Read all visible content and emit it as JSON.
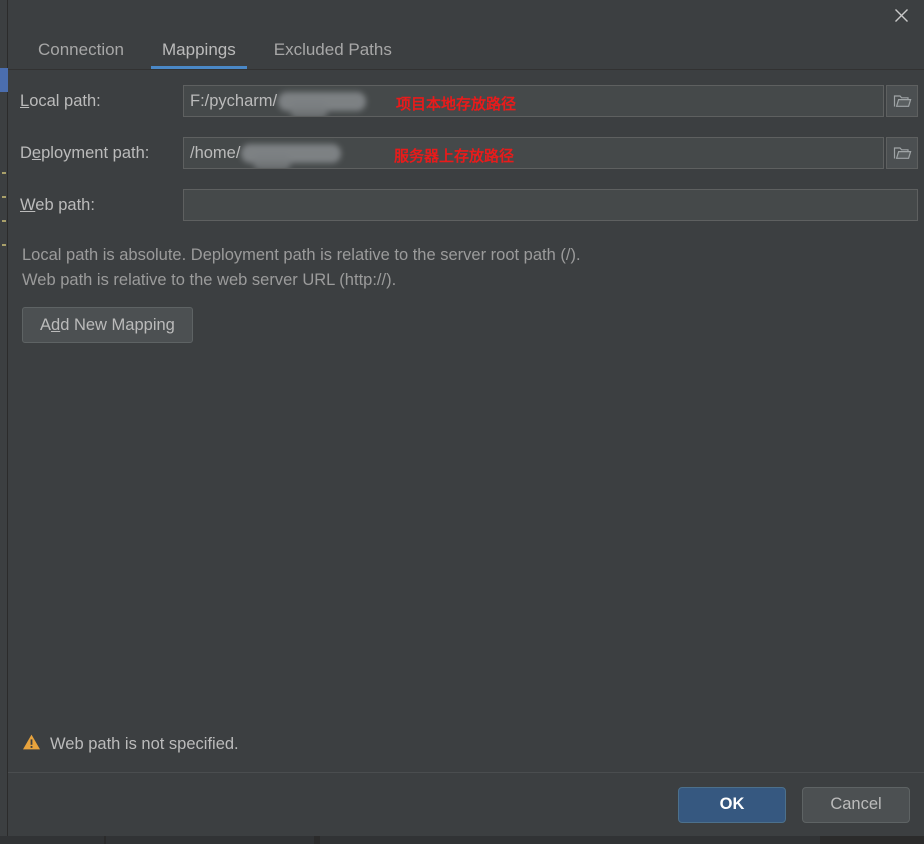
{
  "window": {
    "title": "",
    "close_icon": "close-icon"
  },
  "tabs": [
    {
      "label": "Connection",
      "active": false
    },
    {
      "label": "Mappings",
      "active": true
    },
    {
      "label": "Excluded Paths",
      "active": false
    }
  ],
  "accent_color": "#4a88c7",
  "fields": {
    "local_path": {
      "label_before": "L",
      "label_mnemonic": "L",
      "label": "Local path:",
      "label_pre": "",
      "label_post": "ocal path:",
      "value": "F:/pycharm/",
      "redacted": true,
      "annotation": "项目本地存放路径",
      "browse_icon": "folder-icon"
    },
    "deployment_path": {
      "label": "Deployment path:",
      "label_pre": "D",
      "label_mnemonic": "e",
      "label_post": "ployment path:",
      "value": "/home/",
      "redacted": true,
      "annotation": "服务器上存放路径",
      "browse_icon": "folder-icon"
    },
    "web_path": {
      "label": "Web path:",
      "label_pre": "",
      "label_mnemonic": "W",
      "label_post": "eb path:",
      "value": "",
      "placeholder": "",
      "redacted": false,
      "annotation": ""
    }
  },
  "hint": {
    "line1": "Local path is absolute. Deployment path is relative to the server root path (/).",
    "line2": "Web path is relative to the web server URL (http://)."
  },
  "add_mapping_button": {
    "pre": "A",
    "mnemonic": "d",
    "post": "d New Mapping"
  },
  "warning": {
    "icon": "warning-triangle-icon",
    "text": "Web path is not specified.",
    "color": "#e8a33d"
  },
  "buttons": {
    "ok": "OK",
    "cancel": "Cancel"
  }
}
